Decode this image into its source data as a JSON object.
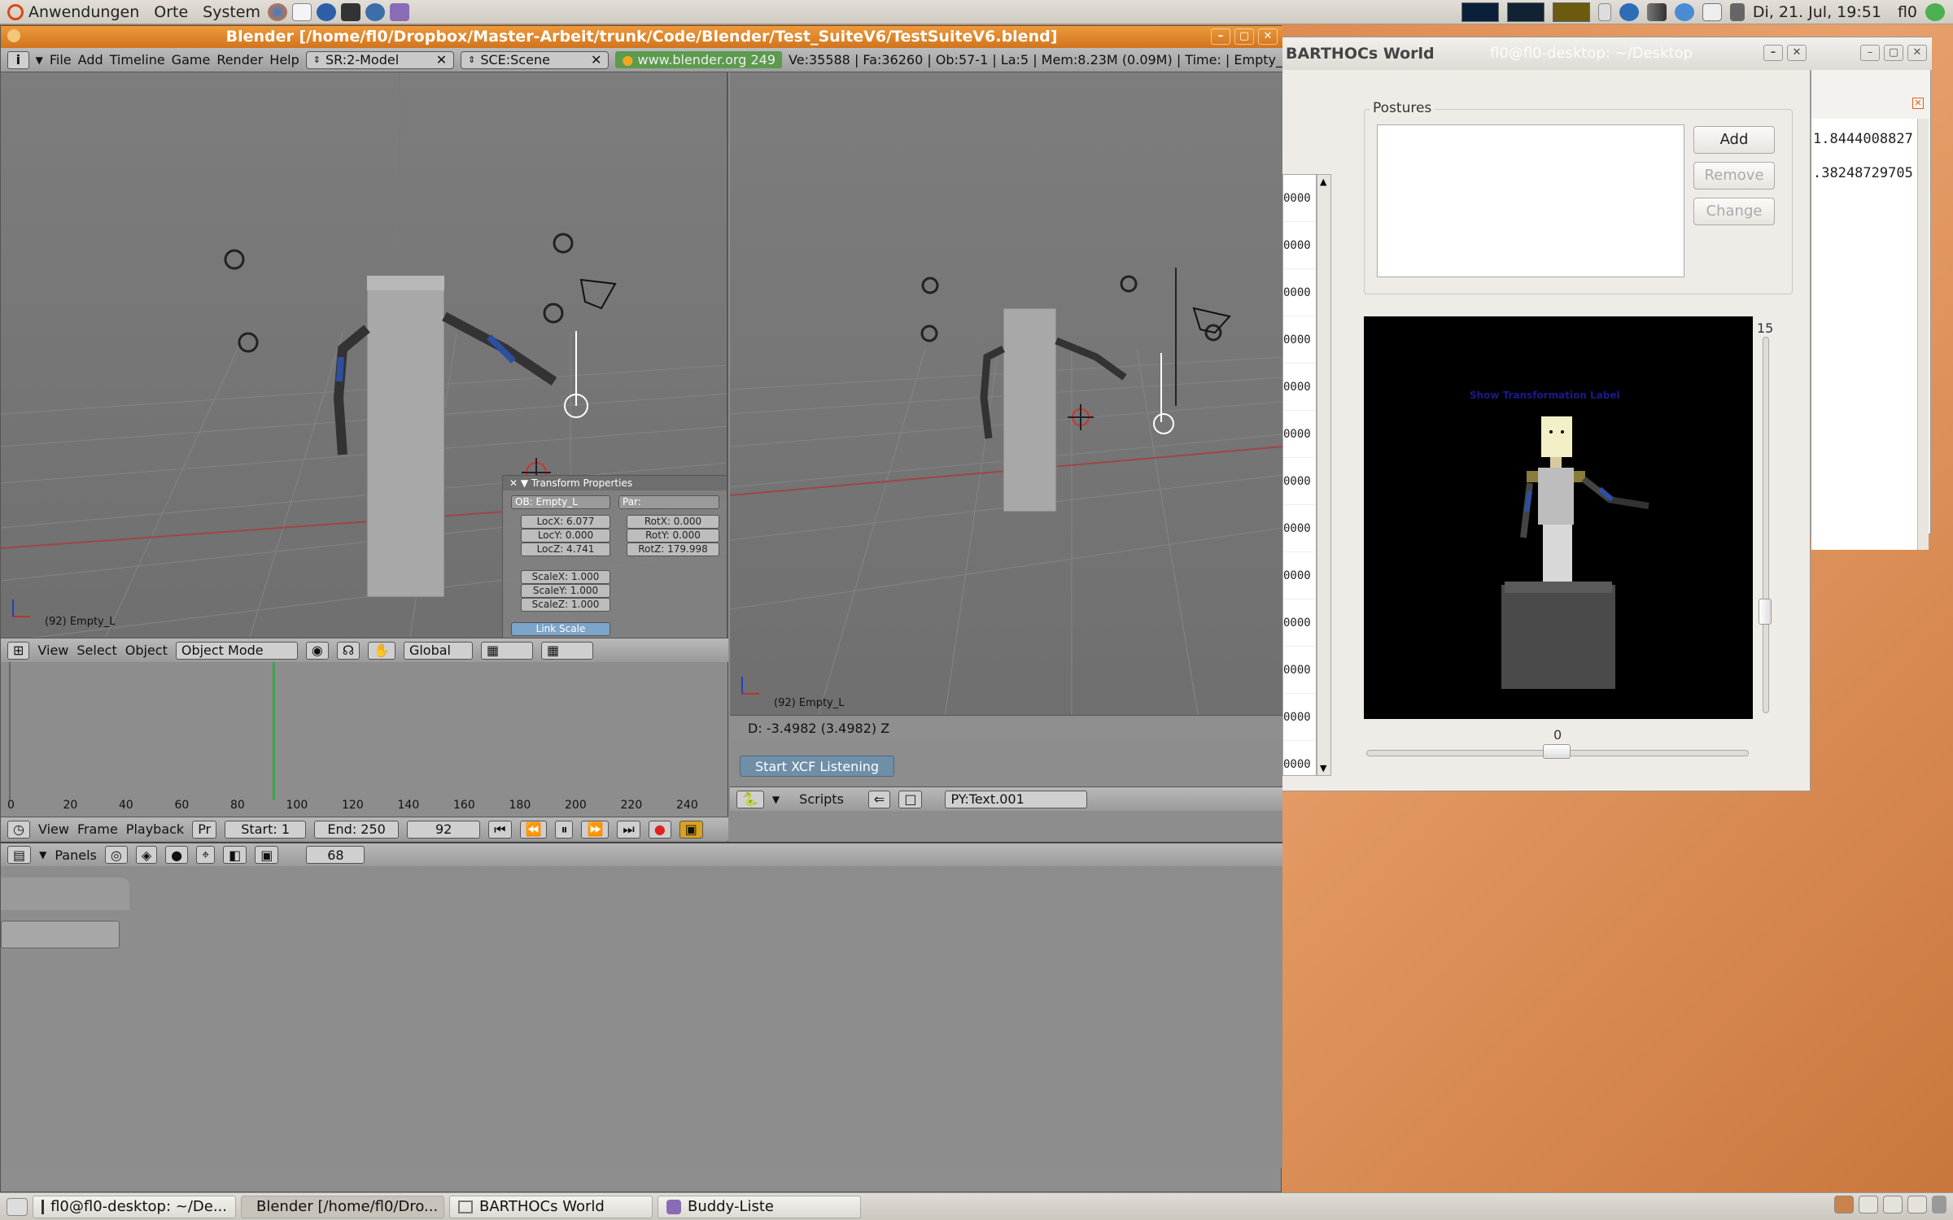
{
  "topbar": {
    "menus": [
      "Anwendungen",
      "Orte",
      "System"
    ],
    "clock": "Di, 21. Jul, 19:51",
    "user": "fl0"
  },
  "blender": {
    "title": "Blender [/home/fl0/Dropbox/Master-Arbeit/trunk/Code/Blender/Test_SuiteV6/TestSuiteV6.blend]",
    "menu": [
      "File",
      "Add",
      "Timeline",
      "Game",
      "Render",
      "Help"
    ],
    "screen_field": "SR:2-Model",
    "scene_field": "SCE:Scene",
    "link": "www.blender.org 249",
    "stats": "Ve:35588 | Fa:36260 | Ob:57-1 | La:5  | Mem:8.23M (0.09M)  | Time: | Empty_",
    "viewport_left": {
      "object_label": "(92) Empty_L",
      "header_menus": [
        "View",
        "Select",
        "Object"
      ],
      "mode": "Object Mode",
      "orientation": "Global"
    },
    "viewport_right": {
      "object_label": "(92) Empty_L",
      "status": "D: -3.4982 (3.4982)  Z"
    },
    "transform": {
      "title": "Transform Properties",
      "ob": "OB: Empty_L",
      "par": "Par:",
      "locx": "LocX: 6.077",
      "locy": "LocY: 0.000",
      "locz": "LocZ: 4.741",
      "rotx": "RotX: 0.000",
      "roty": "RotY: 0.000",
      "rotz": "RotZ: 179.998",
      "scalex": "ScaleX: 1.000",
      "scaley": "ScaleY: 1.000",
      "scalez": "ScaleZ: 1.000",
      "link_scale": "Link Scale"
    },
    "timeline": {
      "ticks": [
        "0",
        "20",
        "40",
        "60",
        "80",
        "100",
        "120",
        "140",
        "160",
        "180",
        "200",
        "220",
        "240"
      ],
      "menus": [
        "View",
        "Frame",
        "Playback"
      ],
      "pr": "Pr",
      "start": "Start: 1",
      "end": "End: 250",
      "frame": "92",
      "current_frame": 92
    },
    "python": {
      "start_button": "Start XCF Listening",
      "scripts_label": "Scripts",
      "text_field": "PY:Text.001"
    },
    "panels": {
      "label": "Panels",
      "value": "68"
    }
  },
  "barthocs": {
    "title": "BARTHOCs World",
    "ghost_title": "fl0@fl0-desktop: ~/Desktop",
    "postures_label": "Postures",
    "add": "Add",
    "remove": "Remove",
    "change": "Change",
    "canvas_text": "Show Transformation Label",
    "slider_v_max": "15",
    "slider_h_value": "0",
    "list_values": [
      "0000",
      "0000",
      "0000",
      "0000",
      "0000",
      "0000",
      "0000",
      "0000",
      "0000",
      "0000",
      "0000",
      "0000",
      "0000"
    ]
  },
  "terminal_right": {
    "line1": "1.8444008827",
    "line2": ".38248729705"
  },
  "taskbar": {
    "items": [
      "fl0@fl0-desktop: ~/De...",
      "Blender [/home/fl0/Dro...",
      "BARTHOCs World",
      "Buddy-Liste"
    ]
  },
  "colors": {
    "blender_title": "#dd7f26",
    "viewport": "#767676",
    "grid_x": "#a04545",
    "desktop": "#cf7d45"
  }
}
